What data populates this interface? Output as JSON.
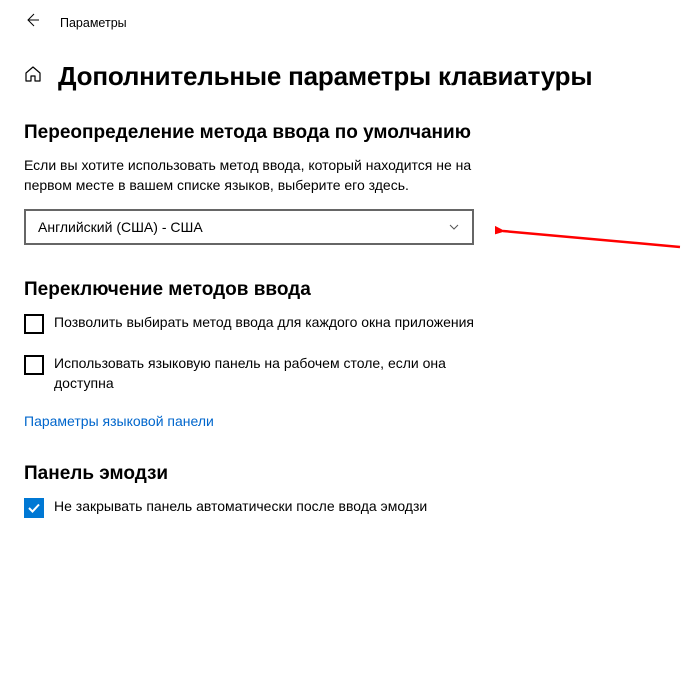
{
  "header": {
    "title": "Параметры"
  },
  "page": {
    "title": "Дополнительные параметры клавиатуры"
  },
  "sections": {
    "override": {
      "heading": "Переопределение метода ввода по умолчанию",
      "description": "Если вы хотите использовать метод ввода, который находится не на первом месте в вашем списке языков, выберите его здесь.",
      "dropdown_selected": "Английский (США) - США"
    },
    "switching": {
      "heading": "Переключение методов ввода",
      "checkbox_per_window": "Позволить выбирать метод ввода для каждого окна приложения",
      "checkbox_langbar": "Использовать языковую панель на рабочем столе, если она доступна",
      "link": "Параметры языковой панели"
    },
    "emoji": {
      "heading": "Панель эмодзи",
      "checkbox_noautoclose": "Не закрывать панель автоматически после ввода эмодзи"
    }
  }
}
